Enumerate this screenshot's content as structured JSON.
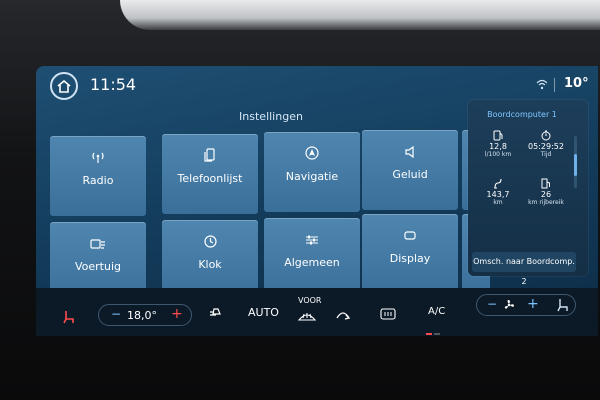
{
  "status": {
    "time": "11:54",
    "outside_temp": "10°",
    "wifi_icon": "wifi-icon"
  },
  "page": {
    "title": "Instellingen"
  },
  "tiles": [
    {
      "label": "Radio",
      "icon": "radio-icon"
    },
    {
      "label": "Telefoonlijst",
      "icon": "phone-icon"
    },
    {
      "label": "Navigatie",
      "icon": "navigation-icon"
    },
    {
      "label": "Geluid",
      "icon": "speaker-icon"
    },
    {
      "label": "Voertuig",
      "icon": "vehicle-icon"
    },
    {
      "label": "Klok",
      "icon": "clock-icon"
    },
    {
      "label": "Algemeen",
      "icon": "sliders-icon"
    },
    {
      "label": "Display",
      "icon": "display-icon"
    }
  ],
  "trip": {
    "title": "Boordcomputer 1",
    "metrics": [
      {
        "value": "12,8",
        "unit": "l/100 km",
        "icon": "fuel-consumption-icon"
      },
      {
        "value": "05:29:52",
        "unit": "Tijd",
        "icon": "stopwatch-icon"
      },
      {
        "value": "143,7",
        "unit": "km",
        "icon": "distance-icon"
      },
      {
        "value": "26",
        "unit": "km rijbereik",
        "icon": "fuel-pump-icon"
      }
    ],
    "switch_label": "Omsch. naar Boordcomp. 2"
  },
  "climate": {
    "driver_temp": "18,0°",
    "minus_label": "−",
    "plus_label": "+",
    "auto_label": "AUTO",
    "voor_label": "VOOR",
    "ac_label": "A/C"
  },
  "colors": {
    "accent_blue": "#7fc6ff",
    "warm_red": "#ff4b4b",
    "tile_blue": "#4a80aa"
  }
}
